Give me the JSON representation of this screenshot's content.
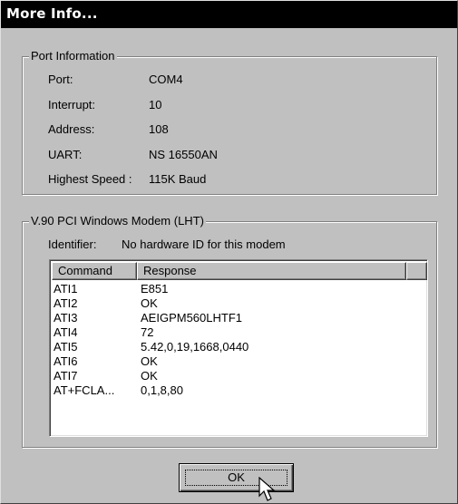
{
  "window": {
    "title": "More Info..."
  },
  "port_info": {
    "legend": "Port Information",
    "rows": [
      {
        "label": "Port:",
        "value": "COM4"
      },
      {
        "label": "Interrupt:",
        "value": "10"
      },
      {
        "label": "Address:",
        "value": "108"
      },
      {
        "label": "UART:",
        "value": "NS 16550AN"
      },
      {
        "label": "Highest Speed :",
        "value": "115K Baud"
      }
    ]
  },
  "modem_info": {
    "legend": "V.90 PCI Windows Modem (LHT)",
    "identifier_label": "Identifier:",
    "identifier_value": "No hardware ID for this modem",
    "columns": [
      "Command",
      "Response"
    ],
    "rows": [
      {
        "command": "ATI1",
        "response": "E851"
      },
      {
        "command": "ATI2",
        "response": "OK"
      },
      {
        "command": "ATI3",
        "response": "AEIGPM560LHTF1"
      },
      {
        "command": "ATI4",
        "response": "72"
      },
      {
        "command": "ATI5",
        "response": "5.42,0,19,1668,0440"
      },
      {
        "command": "ATI6",
        "response": "OK"
      },
      {
        "command": "ATI7",
        "response": "OK"
      },
      {
        "command": "AT+FCLA...",
        "response": "0,1,8,80"
      }
    ]
  },
  "buttons": {
    "ok_label": "OK"
  }
}
